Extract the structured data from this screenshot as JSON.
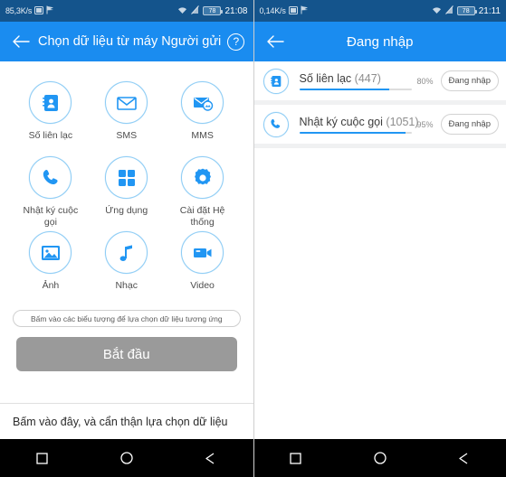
{
  "left": {
    "statusbar": {
      "speed": "85,3K/s",
      "battery": "78",
      "time": "21:08",
      "icons": [
        "screenshot-icon",
        "flag-icon",
        "wifi-icon",
        "signal-off-icon"
      ]
    },
    "appbar": {
      "title": "Chọn dữ liệu từ máy Người gửi",
      "back_icon": "back-arrow-icon",
      "help_icon": "help-icon",
      "help_label": "?"
    },
    "grid": [
      {
        "label": "Số liên lạc",
        "icon": "contacts-icon"
      },
      {
        "label": "SMS",
        "icon": "envelope-icon"
      },
      {
        "label": "MMS",
        "icon": "mms-icon"
      },
      {
        "label": "Nhật ký cuộc gọi",
        "icon": "phone-icon"
      },
      {
        "label": "Ứng dụng",
        "icon": "apps-grid-icon"
      },
      {
        "label": "Cài đặt Hệ thống",
        "icon": "gear-icon"
      },
      {
        "label": "Ảnh",
        "icon": "photo-icon"
      },
      {
        "label": "Nhạc",
        "icon": "music-note-icon"
      },
      {
        "label": "Video",
        "icon": "video-camera-icon"
      }
    ],
    "hint": "Bấm vào các biểu tượng để lựa chọn dữ liệu tương ứng",
    "start_button": "Bắt đầu",
    "bottom_note": "Bấm vào đây, và cẩn thận lựa chọn dữ liệu"
  },
  "right": {
    "statusbar": {
      "speed": "0,14K/s",
      "battery": "78",
      "time": "21:11",
      "icons": [
        "screenshot-icon",
        "flag-icon",
        "wifi-icon",
        "signal-off-icon"
      ]
    },
    "appbar": {
      "title": "Đang nhập",
      "back_icon": "back-arrow-icon"
    },
    "tasks": [
      {
        "title": "Số liên lạc",
        "count": "(447)",
        "percent": "80%",
        "progress": 80,
        "button": "Đang nhập",
        "icon": "contacts-icon"
      },
      {
        "title": "Nhật ký cuộc gọi",
        "count": "(1051)",
        "percent": "95%",
        "progress": 95,
        "button": "Đang nhập",
        "icon": "phone-icon"
      }
    ]
  },
  "navbar": {
    "recent": "square-icon",
    "home": "circle-icon",
    "back": "triangle-back-icon"
  },
  "colors": {
    "statusbar": "#14548c",
    "appbar": "#1a8cf0",
    "accent": "#2196f3",
    "icon_ring": "#8ecdf5",
    "start_button": "#9a9a9a",
    "panel_bg": "#f0f1f2"
  }
}
